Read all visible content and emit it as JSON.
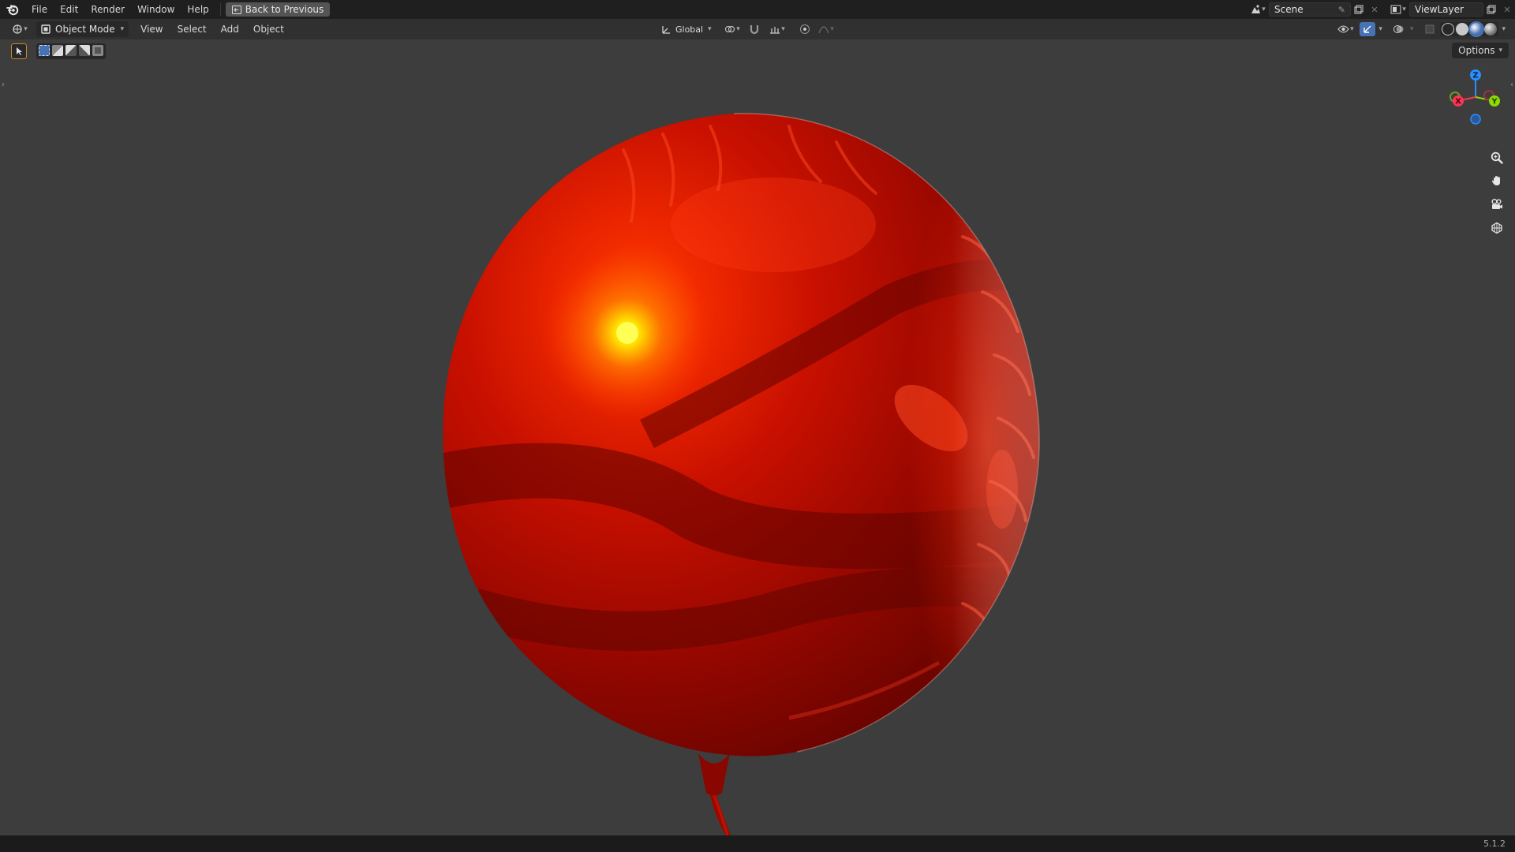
{
  "topbar": {
    "menus": [
      "File",
      "Edit",
      "Render",
      "Window",
      "Help"
    ],
    "back_label": "Back to Previous",
    "scene_name": "Scene",
    "view_layer_name": "ViewLayer"
  },
  "header": {
    "mode_label": "Object Mode",
    "menus": [
      "View",
      "Select",
      "Add",
      "Object"
    ],
    "orientation_label": "Global"
  },
  "viewport": {
    "options_label": "Options",
    "gizmo_axes": {
      "z": "Z",
      "x": "X",
      "y": "Y"
    },
    "nav_icons": [
      "zoom-icon",
      "hand-pan-icon",
      "camera-icon",
      "grid-icon"
    ]
  },
  "statusbar": {
    "version": "5.1.2"
  },
  "colors": {
    "accent_blue": "#4772b3",
    "axis_x": "#ff3352",
    "axis_y": "#8bdc00",
    "axis_z": "#2890ff",
    "balloon_red": "#c00d00"
  }
}
